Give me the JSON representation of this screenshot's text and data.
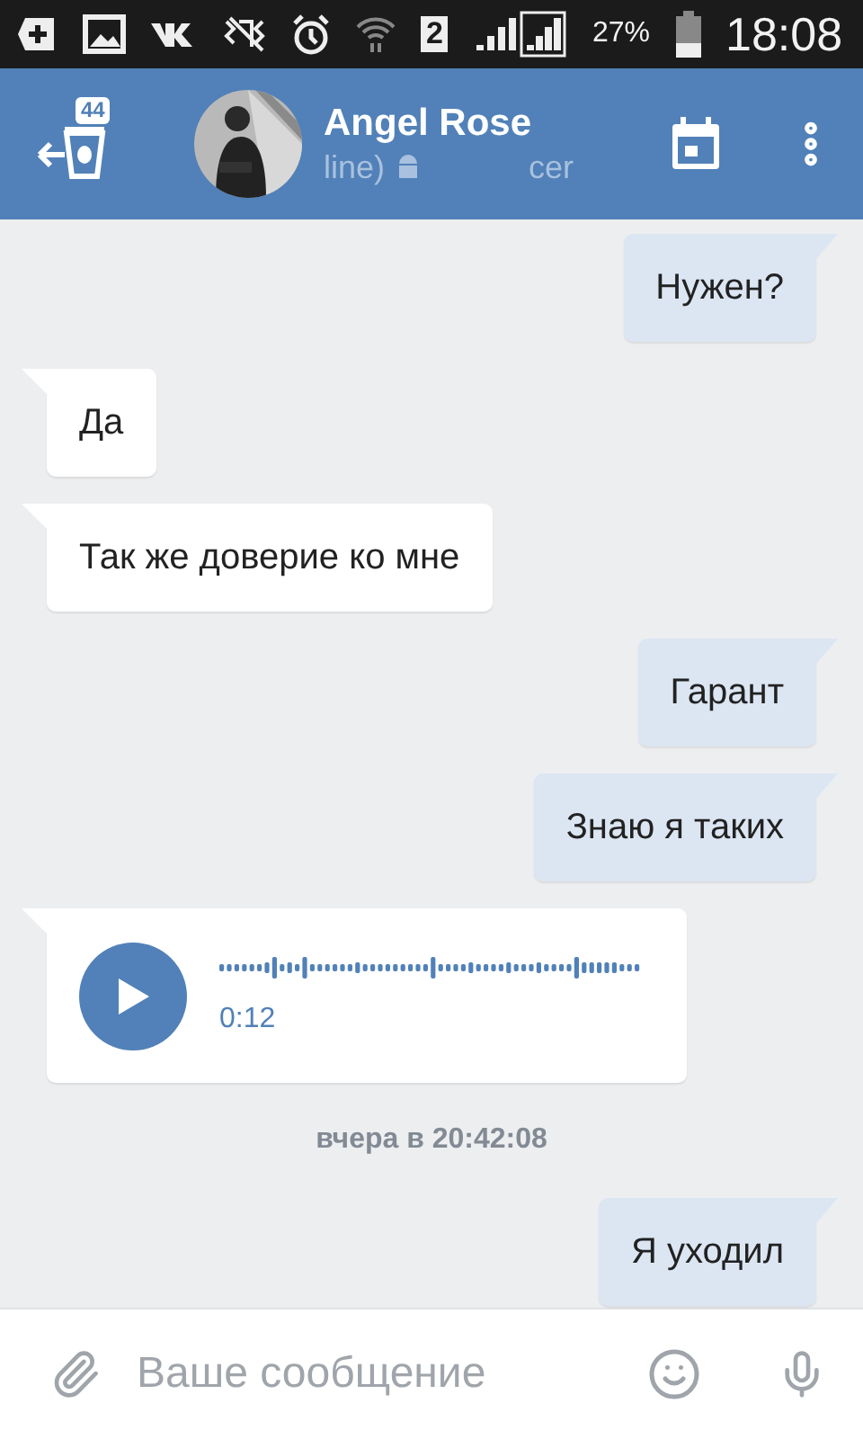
{
  "status_bar": {
    "sim_slot": "2",
    "battery": "27%",
    "time": "18:08"
  },
  "header": {
    "unread_badge": "44",
    "name": "Angel Rose",
    "subtitle_left": "line)",
    "subtitle_right": "cer"
  },
  "messages": [
    {
      "kind": "text",
      "outgoing": true,
      "text": "Нужен?"
    },
    {
      "kind": "text",
      "outgoing": false,
      "text": "Да"
    },
    {
      "kind": "text",
      "outgoing": false,
      "text": "Так же доверие ко мне"
    },
    {
      "kind": "text",
      "outgoing": true,
      "text": "Гарант"
    },
    {
      "kind": "text",
      "outgoing": true,
      "text": "Знаю я таких"
    },
    {
      "kind": "voice",
      "outgoing": false,
      "duration": "0:12"
    },
    {
      "kind": "date",
      "text": "вчера в 20:42:08"
    },
    {
      "kind": "text",
      "outgoing": true,
      "text": "Я уходил"
    }
  ],
  "composer": {
    "placeholder": "Ваше сообщение"
  }
}
